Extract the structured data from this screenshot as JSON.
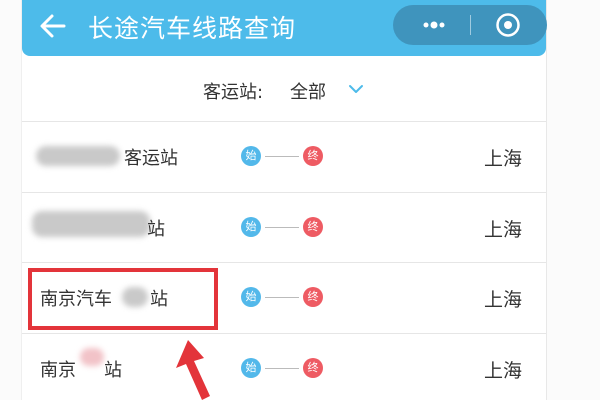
{
  "header": {
    "title": "长途汽车线路查询",
    "back_icon": "arrow-left-icon",
    "capsule": {
      "more_icon": "more-dots-icon",
      "close_icon": "target-close-icon"
    },
    "color": "#4dbbea"
  },
  "filter": {
    "label": "客运站:",
    "value": "全部",
    "icon": "chevron-down-icon"
  },
  "route_marker": {
    "start": "始",
    "end": "终",
    "start_color": "#52b8ea",
    "end_color": "#ee5b63"
  },
  "routes": [
    {
      "station": "客运站",
      "destination": "上海"
    },
    {
      "station": "站",
      "destination": "上海"
    },
    {
      "station": "南京汽车",
      "station_suffix": "站",
      "destination": "上海"
    },
    {
      "station": "南京",
      "station_suffix": "站",
      "destination": "上海"
    }
  ],
  "annotation": {
    "highlight_color": "#e3343a"
  }
}
